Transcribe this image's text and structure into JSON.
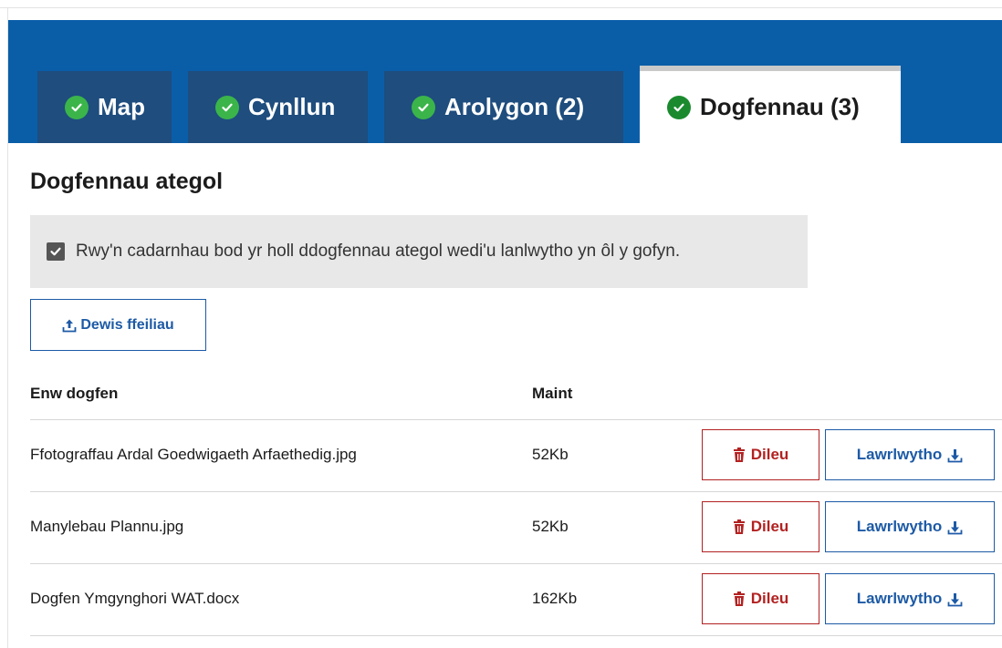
{
  "tabs": [
    {
      "label": "Map",
      "status_icon": "check-circle-icon"
    },
    {
      "label": "Cynllun",
      "status_icon": "check-circle-icon"
    },
    {
      "label": "Arolygon (2)",
      "status_icon": "check-circle-icon"
    },
    {
      "label": "Dogfennau (3)",
      "status_icon": "check-circle-icon",
      "active": true
    }
  ],
  "section": {
    "title": "Dogfennau ategol"
  },
  "confirmation": {
    "checked": true,
    "text": "Rwy'n cadarnhau bod yr holl ddogfennau ategol wedi'u lanlwytho yn ôl y gofyn."
  },
  "upload": {
    "label": "Dewis ffeiliau",
    "icon": "upload-icon"
  },
  "table": {
    "headers": {
      "name": "Enw dogfen",
      "size": "Maint"
    },
    "rows": [
      {
        "name": "Ffotograffau Ardal Goedwigaeth Arfaethedig.jpg",
        "size": "52Kb"
      },
      {
        "name": "Manylebau Plannu.jpg",
        "size": "52Kb"
      },
      {
        "name": "Dogfen Ymgynghori WAT.docx",
        "size": "162Kb"
      }
    ],
    "delete_label": "Dileu",
    "download_label": "Lawrlwytho"
  },
  "colors": {
    "header_blue": "#0a5ea8",
    "tab_dark": "#1e4d7e",
    "check_green": "#3bb54a",
    "link_blue": "#1d5aa6",
    "danger_red": "#b32121"
  }
}
